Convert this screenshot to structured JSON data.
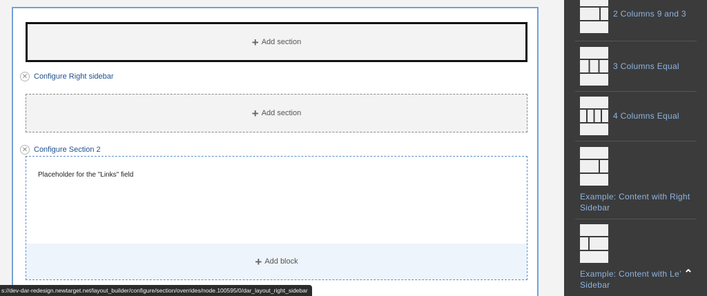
{
  "builder": {
    "add_section_label": "Add section",
    "configure_right_sidebar": "Configure Right sidebar",
    "configure_section_2": "Configure Section 2",
    "placeholder_links": "Placeholder for the \"Links\" field",
    "add_block_label": "Add block"
  },
  "status_url": "s://dev-dar-redesign.newtarget.net/layout_builder/configure/section/overrides/node.100595/0/dar_layout_right_sidebar",
  "sidebar": {
    "layouts": [
      {
        "label": "2 Columns 9 and 3",
        "icon": "layout-2col-9-3-icon"
      },
      {
        "label": "3 Columns Equal",
        "icon": "layout-3col-equal-icon"
      },
      {
        "label": "4 Columns Equal",
        "icon": "layout-4col-equal-icon"
      },
      {
        "label": "Example: Content with Right Sidebar",
        "icon": "layout-right-sidebar-icon"
      },
      {
        "label": "Example: Content with Le’ Sidebar",
        "icon": "layout-left-sidebar-icon"
      }
    ]
  },
  "colors": {
    "sidebar_bg": "#3b3b3b",
    "link_blue": "#1f4f8f",
    "sidebar_link": "#8db4e0",
    "frame_blue": "#6fa3d6"
  }
}
